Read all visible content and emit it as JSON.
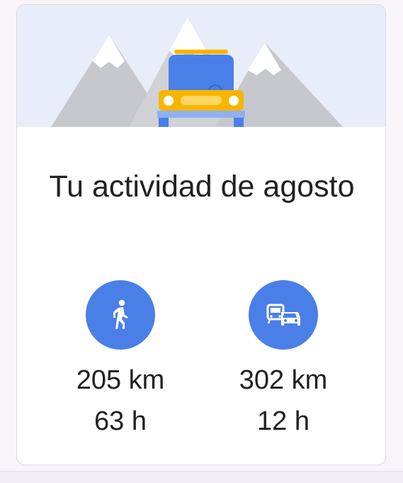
{
  "card": {
    "title": "Tu actividad de agosto"
  },
  "stats": [
    {
      "icon": "walking-person-icon",
      "distance": "205 km",
      "duration": "63 h"
    },
    {
      "icon": "transit-and-car-icon",
      "distance": "302 km",
      "duration": "12 h"
    }
  ],
  "colors": {
    "accent": "#4a7fe8",
    "car_body": "#4a7fe8",
    "car_bumper": "#f7b500",
    "mountains": "#c9cbd0",
    "sky": "#e7edf9"
  }
}
